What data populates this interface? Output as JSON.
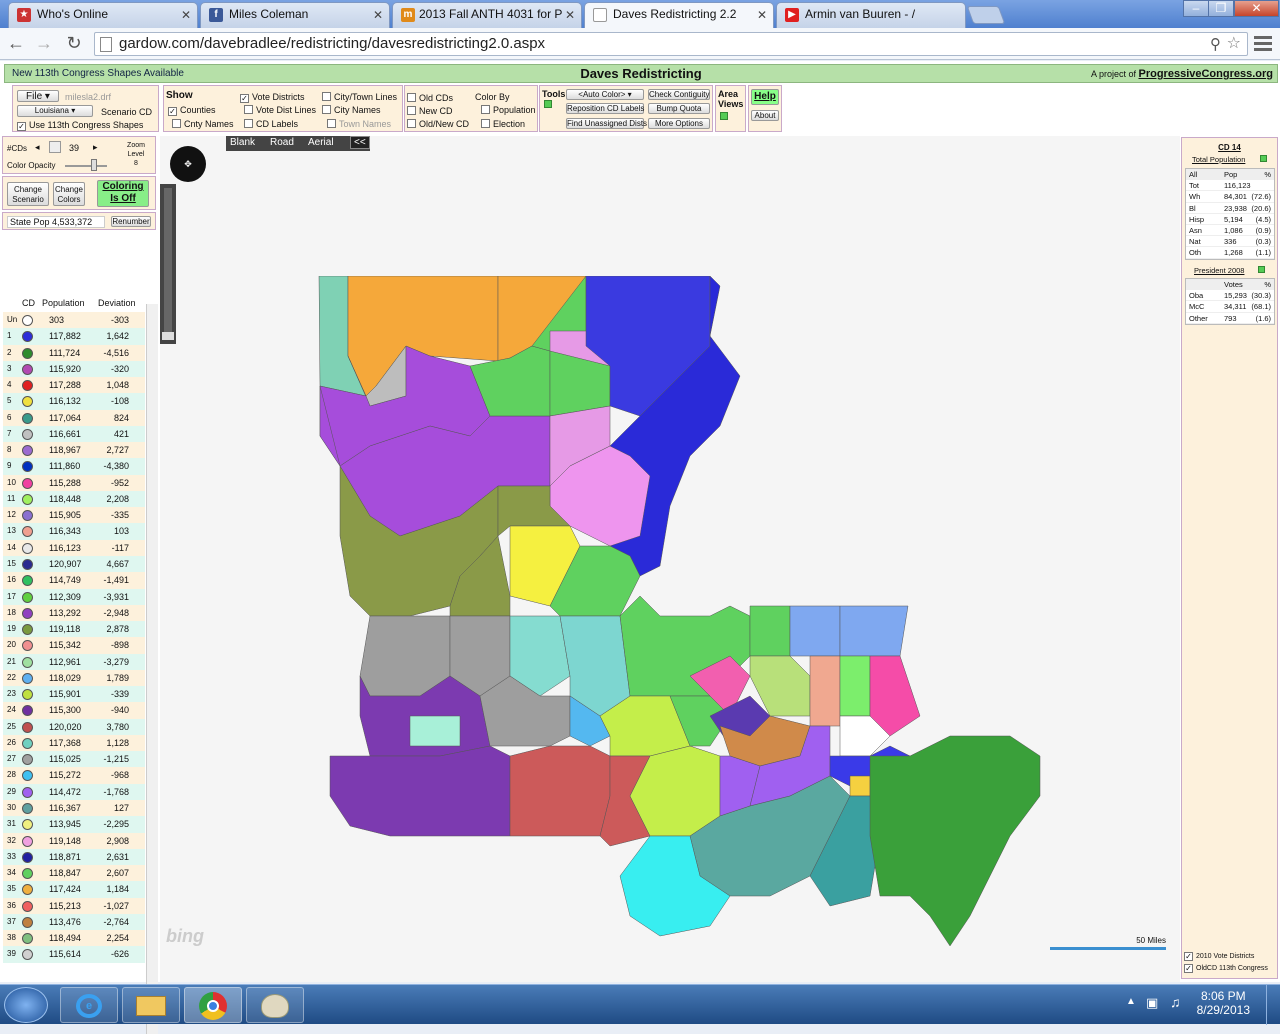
{
  "browser": {
    "tabs": [
      {
        "title": "Who's Online",
        "active": false,
        "icon": "flag-icon"
      },
      {
        "title": "Miles Coleman",
        "active": false,
        "icon": "facebook-icon"
      },
      {
        "title": "2013 Fall ANTH 4031 for P",
        "active": false,
        "icon": "moodle-icon"
      },
      {
        "title": "Daves Redistricting 2.2",
        "active": true,
        "icon": "page-icon"
      },
      {
        "title": "Armin van Buuren - /",
        "active": false,
        "icon": "youtube-icon"
      }
    ],
    "url": "gardow.com/davebradlee/redistricting/davesredistricting2.0.aspx"
  },
  "header": {
    "left": "New 113th Congress Shapes Available",
    "title": "Daves Redistricting",
    "right_prefix": "A project of",
    "right_link": "ProgressiveCongress.org"
  },
  "controls": {
    "file_label": "File",
    "filename": "milesla2.drf",
    "state": "Louisiana",
    "scenario": "Scenario CD",
    "use113": "Use 113th Congress Shapes",
    "show_label": "Show",
    "counties": "Counties",
    "cnty_names": "Cnty Names",
    "vote_districts": "Vote Districts",
    "vote_dist_lines": "Vote Dist Lines",
    "cd_labels": "CD Labels",
    "city_lines": "City/Town Lines",
    "city_names": "City Names",
    "town_names": "Town Names",
    "old_cds": "Old CDs",
    "new_cd": "New CD",
    "old_new_cd": "Old/New CD",
    "color_by": "Color By",
    "population": "Population",
    "election": "Election",
    "tools": "Tools",
    "auto_color": "<Auto Color>",
    "reposition": "Reposition CD Labels",
    "find_unassigned": "Find Unassigned Dists",
    "check_contiguity": "Check Contiguity",
    "bump_quota": "Bump Quota",
    "more_options": "More Options",
    "area_views": "Area Views",
    "help": "Help",
    "about": "About"
  },
  "left": {
    "ncds_label": "#CDs",
    "ncds_value": "39",
    "zoom_label": "Zoom Level",
    "zoom_value": "8",
    "opacity_label": "Color Opacity",
    "change_scenario": "Change Scenario",
    "change_colors": "Change Colors",
    "coloring": "Coloring Is Off",
    "state_pop_label": "State Pop",
    "state_pop": "4,533,372",
    "renumber": "Renumber",
    "col_cd": "CD",
    "col_pop": "Population",
    "col_dev": "Deviation",
    "rows": [
      {
        "cd": "Un",
        "pop": "303",
        "dev": "-303",
        "color": "#ffffff"
      },
      {
        "cd": "1",
        "pop": "117,882",
        "dev": "1,642",
        "color": "#2d2dd8"
      },
      {
        "cd": "2",
        "pop": "111,724",
        "dev": "-4,516",
        "color": "#2e8b2e"
      },
      {
        "cd": "3",
        "pop": "115,920",
        "dev": "-320",
        "color": "#b24ab2"
      },
      {
        "cd": "4",
        "pop": "117,288",
        "dev": "1,048",
        "color": "#e02020"
      },
      {
        "cd": "5",
        "pop": "116,132",
        "dev": "-108",
        "color": "#f0e040"
      },
      {
        "cd": "6",
        "pop": "117,064",
        "dev": "824",
        "color": "#3a9b8b"
      },
      {
        "cd": "7",
        "pop": "116,661",
        "dev": "421",
        "color": "#c0c0c0"
      },
      {
        "cd": "8",
        "pop": "118,967",
        "dev": "2,727",
        "color": "#9b6bd0"
      },
      {
        "cd": "9",
        "pop": "111,860",
        "dev": "-4,380",
        "color": "#0030c0"
      },
      {
        "cd": "10",
        "pop": "115,288",
        "dev": "-952",
        "color": "#f040a0"
      },
      {
        "cd": "11",
        "pop": "118,448",
        "dev": "2,208",
        "color": "#a0f060"
      },
      {
        "cd": "12",
        "pop": "115,905",
        "dev": "-335",
        "color": "#8a70d0"
      },
      {
        "cd": "13",
        "pop": "116,343",
        "dev": "103",
        "color": "#f0a090"
      },
      {
        "cd": "14",
        "pop": "116,123",
        "dev": "-117",
        "color": "#e8e8e8"
      },
      {
        "cd": "15",
        "pop": "120,907",
        "dev": "4,667",
        "color": "#2a2a90"
      },
      {
        "cd": "16",
        "pop": "114,749",
        "dev": "-1,491",
        "color": "#30c060"
      },
      {
        "cd": "17",
        "pop": "112,309",
        "dev": "-3,931",
        "color": "#60d040"
      },
      {
        "cd": "18",
        "pop": "113,292",
        "dev": "-2,948",
        "color": "#9040c0"
      },
      {
        "cd": "19",
        "pop": "119,118",
        "dev": "2,878",
        "color": "#7a9a40"
      },
      {
        "cd": "20",
        "pop": "115,342",
        "dev": "-898",
        "color": "#f09090"
      },
      {
        "cd": "21",
        "pop": "112,961",
        "dev": "-3,279",
        "color": "#a0e0a0"
      },
      {
        "cd": "22",
        "pop": "118,029",
        "dev": "1,789",
        "color": "#60b0f0"
      },
      {
        "cd": "23",
        "pop": "115,901",
        "dev": "-339",
        "color": "#c0e040"
      },
      {
        "cd": "24",
        "pop": "115,300",
        "dev": "-940",
        "color": "#7030a0"
      },
      {
        "cd": "25",
        "pop": "120,020",
        "dev": "3,780",
        "color": "#c05050"
      },
      {
        "cd": "26",
        "pop": "117,368",
        "dev": "1,128",
        "color": "#70d0c0"
      },
      {
        "cd": "27",
        "pop": "115,025",
        "dev": "-1,215",
        "color": "#a0a0a0"
      },
      {
        "cd": "28",
        "pop": "115,272",
        "dev": "-968",
        "color": "#40c0f0"
      },
      {
        "cd": "29",
        "pop": "114,472",
        "dev": "-1,768",
        "color": "#a060f0"
      },
      {
        "cd": "30",
        "pop": "116,367",
        "dev": "127",
        "color": "#60a0a0"
      },
      {
        "cd": "31",
        "pop": "113,945",
        "dev": "-2,295",
        "color": "#f0f080"
      },
      {
        "cd": "32",
        "pop": "119,148",
        "dev": "2,908",
        "color": "#f0a0e0"
      },
      {
        "cd": "33",
        "pop": "118,871",
        "dev": "2,631",
        "color": "#2020a0"
      },
      {
        "cd": "34",
        "pop": "118,847",
        "dev": "2,607",
        "color": "#60d060"
      },
      {
        "cd": "35",
        "pop": "117,424",
        "dev": "1,184",
        "color": "#f0b040"
      },
      {
        "cd": "36",
        "pop": "115,213",
        "dev": "-1,027",
        "color": "#f06060"
      },
      {
        "cd": "37",
        "pop": "113,476",
        "dev": "-2,764",
        "color": "#c08040"
      },
      {
        "cd": "38",
        "pop": "118,494",
        "dev": "2,254",
        "color": "#80c080"
      },
      {
        "cd": "39",
        "pop": "115,614",
        "dev": "-626",
        "color": "#d0d0d0"
      }
    ]
  },
  "map": {
    "modes": [
      "Blank",
      "Road",
      "Aerial"
    ],
    "collapse": "<<",
    "provider": "bing",
    "scale": "50 Miles"
  },
  "right": {
    "cd_title": "CD 14",
    "pop_title": "Total Population",
    "pop_head": [
      "All",
      "Pop",
      "%"
    ],
    "pop_rows": [
      [
        "Tot",
        "116,123",
        ""
      ],
      [
        "Wh",
        "84,301",
        "(72.6)"
      ],
      [
        "Bl",
        "23,938",
        "(20.6)"
      ],
      [
        "Hisp",
        "5,194",
        "(4.5)"
      ],
      [
        "Asn",
        "1,086",
        "(0.9)"
      ],
      [
        "Nat",
        "336",
        "(0.3)"
      ],
      [
        "Oth",
        "1,268",
        "(1.1)"
      ]
    ],
    "pres_title": "President 2008",
    "pres_head": [
      "",
      "Votes",
      "%"
    ],
    "pres_rows": [
      [
        "Oba",
        "15,293",
        "(30.3)"
      ],
      [
        "McC",
        "34,311",
        "(68.1)"
      ],
      [
        "Other",
        "793",
        "(1.6)"
      ]
    ],
    "legend1": "2010 Vote Districts",
    "legend2": "OldCD 113th Congress"
  },
  "taskbar": {
    "time": "8:06 PM",
    "date": "8/29/2013"
  }
}
